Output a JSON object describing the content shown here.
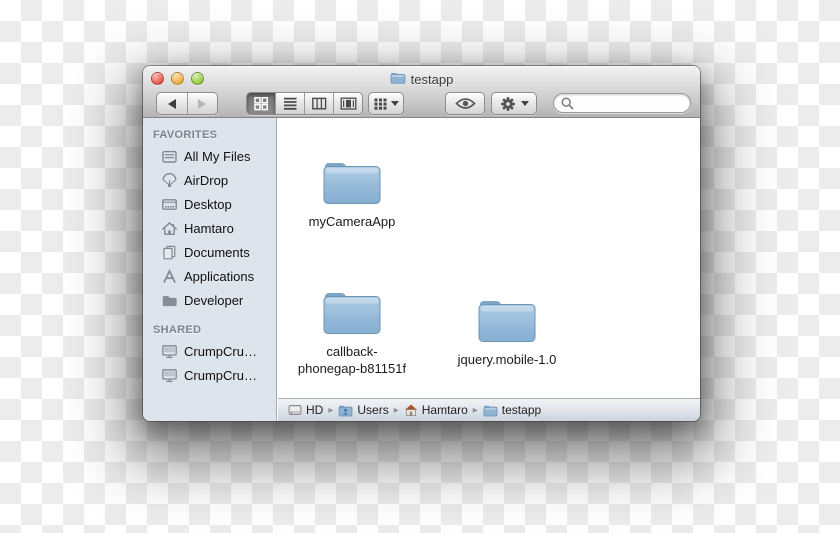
{
  "background": {
    "pattern": "transparency-checkerboard",
    "checker_colors": [
      "#ffffff",
      "#ececec"
    ]
  },
  "window": {
    "title": "testapp",
    "title_icon": "folder-icon",
    "traffic_lights": [
      {
        "name": "close",
        "color": "#e8564b"
      },
      {
        "name": "minimize",
        "color": "#eead3e"
      },
      {
        "name": "zoom",
        "color": "#9ac940"
      }
    ]
  },
  "toolbar": {
    "nav": [
      {
        "icon": "back-arrow-icon",
        "enabled": true
      },
      {
        "icon": "forward-arrow-icon",
        "enabled": false
      }
    ],
    "view_segments": [
      {
        "icon": "icon-view-icon",
        "selected": true
      },
      {
        "icon": "list-view-icon",
        "selected": false
      },
      {
        "icon": "column-view-icon",
        "selected": false
      },
      {
        "icon": "coverflow-view-icon",
        "selected": false
      }
    ],
    "arrange": {
      "icon": "arrange-grid-icon",
      "has_dropdown": true
    },
    "quick_look": {
      "icon": "eye-icon"
    },
    "action": {
      "icon": "gear-icon",
      "has_dropdown": true
    },
    "search": {
      "icon": "magnifier-icon",
      "value": "",
      "placeholder": ""
    }
  },
  "sidebar": {
    "sections": [
      {
        "title": "FAVORITES",
        "items": [
          {
            "label": "All My Files",
            "icon": "all-my-files-icon"
          },
          {
            "label": "AirDrop",
            "icon": "airdrop-icon"
          },
          {
            "label": "Desktop",
            "icon": "desktop-icon"
          },
          {
            "label": "Hamtaro",
            "icon": "home-icon"
          },
          {
            "label": "Documents",
            "icon": "documents-icon"
          },
          {
            "label": "Applications",
            "icon": "applications-icon"
          },
          {
            "label": "Developer",
            "icon": "folder-icon"
          }
        ]
      },
      {
        "title": "SHARED",
        "items": [
          {
            "label": "CrumpCru…",
            "icon": "display-icon"
          },
          {
            "label": "CrumpCru…",
            "icon": "display-icon"
          }
        ]
      }
    ]
  },
  "main": {
    "folders": [
      {
        "name": "myCameraApp",
        "lines": [
          "myCameraApp",
          ""
        ],
        "icon": "folder-icon"
      },
      {
        "name": "callback-phonegap-b81151f",
        "lines": [
          "callback-",
          "phonegap-b81151f"
        ],
        "icon": "folder-icon"
      },
      {
        "name": "jquery.mobile-1.0",
        "lines": [
          "jquery.mobile-1.0",
          ""
        ],
        "icon": "folder-icon"
      }
    ]
  },
  "path_bar": {
    "separator": "▸",
    "items": [
      {
        "label": "HD",
        "icon": "drive-icon"
      },
      {
        "label": "Users",
        "icon": "users-folder-icon"
      },
      {
        "label": "Hamtaro",
        "icon": "home-icon"
      },
      {
        "label": "testapp",
        "icon": "folder-icon"
      }
    ]
  },
  "colors": {
    "folder_blue_top": "#aecde5",
    "folder_blue_bottom": "#86afd0",
    "sidebar_bg": "#dee4ec",
    "chrome_top": "#f2f2f2",
    "chrome_bottom": "#b3b3b3",
    "pathbar_bottom": "#ccd3dd",
    "sidebar_header_text": "#7b8493"
  }
}
